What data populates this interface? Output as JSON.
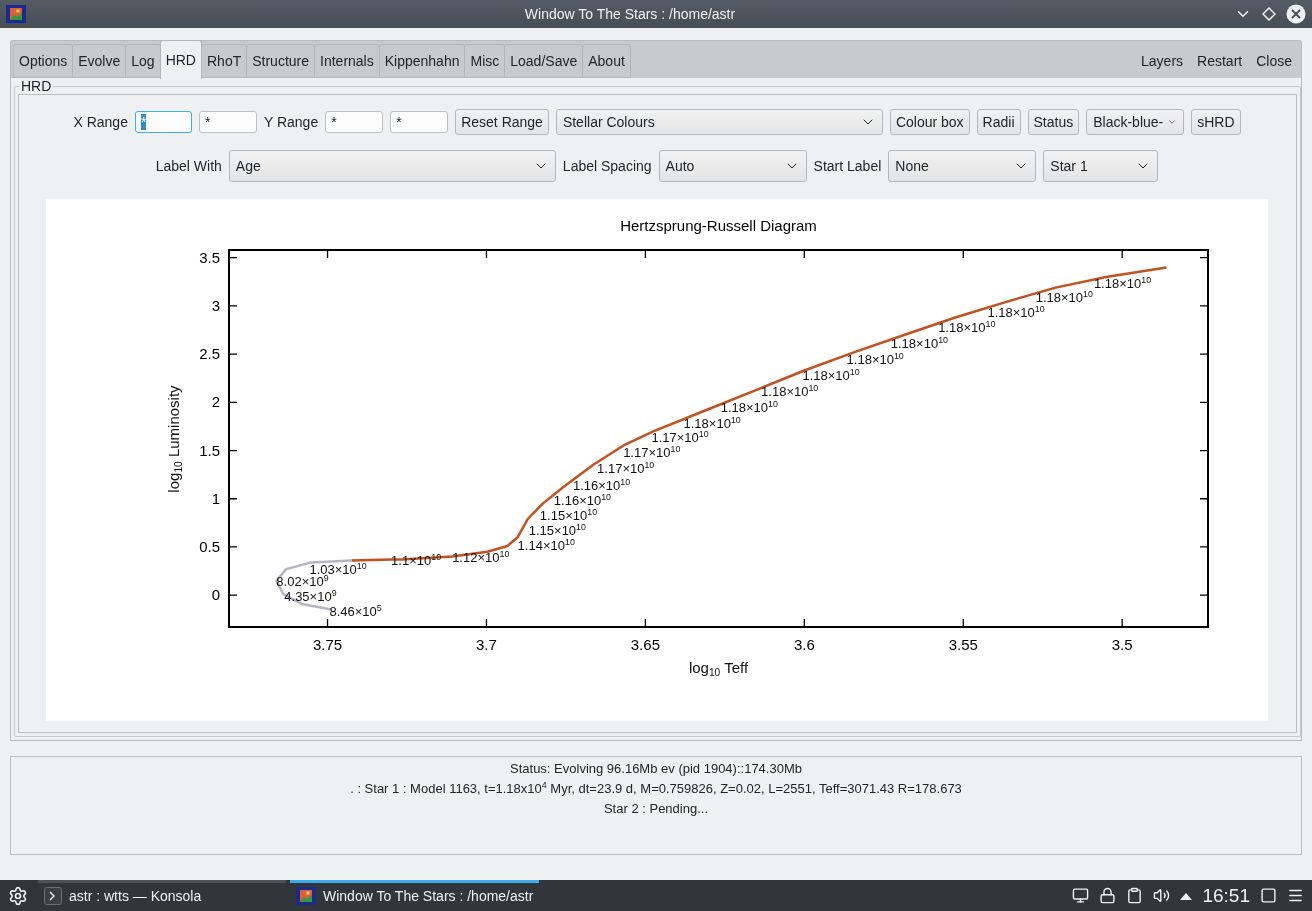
{
  "window": {
    "title": "Window To The Stars : /home/astr"
  },
  "tabs": [
    {
      "label": "Options",
      "selected": false
    },
    {
      "label": "Evolve",
      "selected": false
    },
    {
      "label": "Log",
      "selected": false
    },
    {
      "label": "HRD",
      "selected": true
    },
    {
      "label": "RhoT",
      "selected": false
    },
    {
      "label": "Structure",
      "selected": false
    },
    {
      "label": "Internals",
      "selected": false
    },
    {
      "label": "Kippenhahn",
      "selected": false
    },
    {
      "label": "Misc",
      "selected": false
    },
    {
      "label": "Load/Save",
      "selected": false
    },
    {
      "label": "About",
      "selected": false
    }
  ],
  "corner_buttons": [
    "Layers",
    "Restart",
    "Close"
  ],
  "group": {
    "title": "HRD",
    "rows": [
      {
        "items": [
          {
            "kind": "label",
            "text": "X Range"
          },
          {
            "kind": "field",
            "value": "*",
            "focused": true
          },
          {
            "kind": "field",
            "value": "*",
            "focused": false
          },
          {
            "kind": "label",
            "text": "Y Range"
          },
          {
            "kind": "field",
            "value": "*",
            "focused": false
          },
          {
            "kind": "field",
            "value": "*",
            "focused": false
          },
          {
            "kind": "button",
            "text": "Reset Range"
          },
          {
            "kind": "combo",
            "text": "Stellar Colours"
          },
          {
            "kind": "button",
            "text": "Colour box"
          },
          {
            "kind": "button",
            "text": "Radii"
          },
          {
            "kind": "button",
            "text": "Status"
          },
          {
            "kind": "combo",
            "text": "Black-blue-"
          },
          {
            "kind": "button",
            "text": "sHRD"
          }
        ]
      },
      {
        "items": [
          {
            "kind": "label",
            "text": "Label With"
          },
          {
            "kind": "combo",
            "text": "Age"
          },
          {
            "kind": "label",
            "text": "Label Spacing"
          },
          {
            "kind": "combo",
            "text": "Auto"
          },
          {
            "kind": "label",
            "text": "Start Label"
          },
          {
            "kind": "combo",
            "text": "None"
          },
          {
            "kind": "combo",
            "text": "Star 1"
          }
        ]
      }
    ],
    "chart_data": {
      "type": "line",
      "title": "Hertzsprung-Russell Diagram",
      "xlabel": "log$_{10}$ Teff",
      "ylabel": "log$_{10}$ Luminosity",
      "x": [
        3.7487,
        3.7582,
        3.7639,
        3.7661,
        3.763,
        3.7551,
        3.7424,
        3.73,
        3.7266,
        3.7108,
        3.6997,
        3.6934,
        3.6902,
        3.687,
        3.6823,
        3.6759,
        3.6665,
        3.657,
        3.6475,
        3.6316,
        3.6158,
        3.6,
        3.5842,
        3.5684,
        3.5525,
        3.5367,
        3.5209,
        3.5051,
        3.4861
      ],
      "series": [
        {
          "color": "#b4b4c6",
          "values": [
            -0.15,
            -0.09,
            0.01,
            0.15,
            0.27,
            0.34,
            0.36,
            null,
            null,
            null,
            null,
            null,
            null,
            null,
            null,
            null,
            null,
            null,
            null,
            null,
            null,
            null,
            null,
            null,
            null,
            null,
            null,
            null,
            null
          ]
        },
        {
          "color": "#c4501e",
          "values": [
            null,
            null,
            null,
            null,
            null,
            null,
            0.36,
            0.37,
            0.37,
            0.4,
            0.45,
            0.51,
            0.6,
            0.79,
            0.95,
            1.12,
            1.35,
            1.55,
            1.7,
            1.91,
            2.12,
            2.33,
            2.52,
            2.7,
            2.88,
            3.04,
            3.19,
            3.3,
            3.4
          ]
        }
      ],
      "xlim": [
        3.781,
        3.473
      ],
      "ylim": [
        -0.33,
        3.58
      ],
      "xticks": [
        3.75,
        3.7,
        3.65,
        3.6,
        3.55,
        3.5
      ],
      "yticks": [
        0,
        0.5,
        1,
        1.5,
        2,
        2.5,
        3,
        3.5
      ],
      "annotations": [
        {
          "text": "1.03×10$^{10}$",
          "x": 3.7557,
          "y": 0.27
        },
        {
          "text": "8.02×10$^{9}$",
          "x": 3.7661,
          "y": 0.145
        },
        {
          "text": "4.35×10$^{9}$",
          "x": 3.7636,
          "y": -0.01
        },
        {
          "text": "8.46×10$^{5}$",
          "x": 3.7494,
          "y": -0.166
        },
        {
          "text": "1.1×10$^{10}$",
          "x": 3.73,
          "y": 0.37
        },
        {
          "text": "1.12×10$^{10}$",
          "x": 3.7108,
          "y": 0.4
        },
        {
          "text": "1.14×10$^{10}$",
          "x": 3.6902,
          "y": 0.519
        },
        {
          "text": "1.15×10$^{10}$",
          "x": 3.6867,
          "y": 0.675
        },
        {
          "text": "1.15×10$^{10}$",
          "x": 3.6832,
          "y": 0.831
        },
        {
          "text": "1.16×10$^{10}$",
          "x": 3.6788,
          "y": 0.986
        },
        {
          "text": "1.16×10$^{10}$",
          "x": 3.6728,
          "y": 1.142
        },
        {
          "text": "1.17×10$^{10}$",
          "x": 3.6652,
          "y": 1.318
        },
        {
          "text": "1.17×10$^{10}$",
          "x": 3.657,
          "y": 1.485
        },
        {
          "text": "1.17×10$^{10}$",
          "x": 3.6481,
          "y": 1.641
        },
        {
          "text": "1.18×10$^{10}$",
          "x": 3.638,
          "y": 1.786
        },
        {
          "text": "1.18×10$^{10}$",
          "x": 3.6263,
          "y": 1.952
        },
        {
          "text": "1.18×10$^{10}$",
          "x": 3.6136,
          "y": 2.118
        },
        {
          "text": "1.18×10$^{10}$",
          "x": 3.6006,
          "y": 2.284
        },
        {
          "text": "1.18×10$^{10}$",
          "x": 3.5867,
          "y": 2.45
        },
        {
          "text": "1.18×10$^{10}$",
          "x": 3.5728,
          "y": 2.617
        },
        {
          "text": "1.18×10$^{10}$",
          "x": 3.5579,
          "y": 2.783
        },
        {
          "text": "1.18×10$^{10}$",
          "x": 3.5424,
          "y": 2.939
        },
        {
          "text": "1.18×10$^{10}$",
          "x": 3.5272,
          "y": 3.094
        },
        {
          "text": "1.18×10$^{10}$",
          "x": 3.5089,
          "y": 3.24
        }
      ]
    }
  },
  "status": {
    "lines": [
      "Status: Evolving  96.16Mb ev (pid 1904)::174.30Mb",
      ". : Star 1 : Model 1163, t=1.18x10$^{4}$ Myr, dt=23.9 d, M=0.759826, Z=0.02, L=2551, Teff=3071.43 R=178.673",
      "Star 2 : Pending..."
    ]
  },
  "taskbar": {
    "tasks": [
      {
        "label": "astr : wtts — Konsola",
        "kind": "terminal",
        "selected": false
      },
      {
        "label": "Window To The Stars : /home/astr",
        "kind": "app",
        "selected": true
      }
    ],
    "clock": "16:51"
  }
}
